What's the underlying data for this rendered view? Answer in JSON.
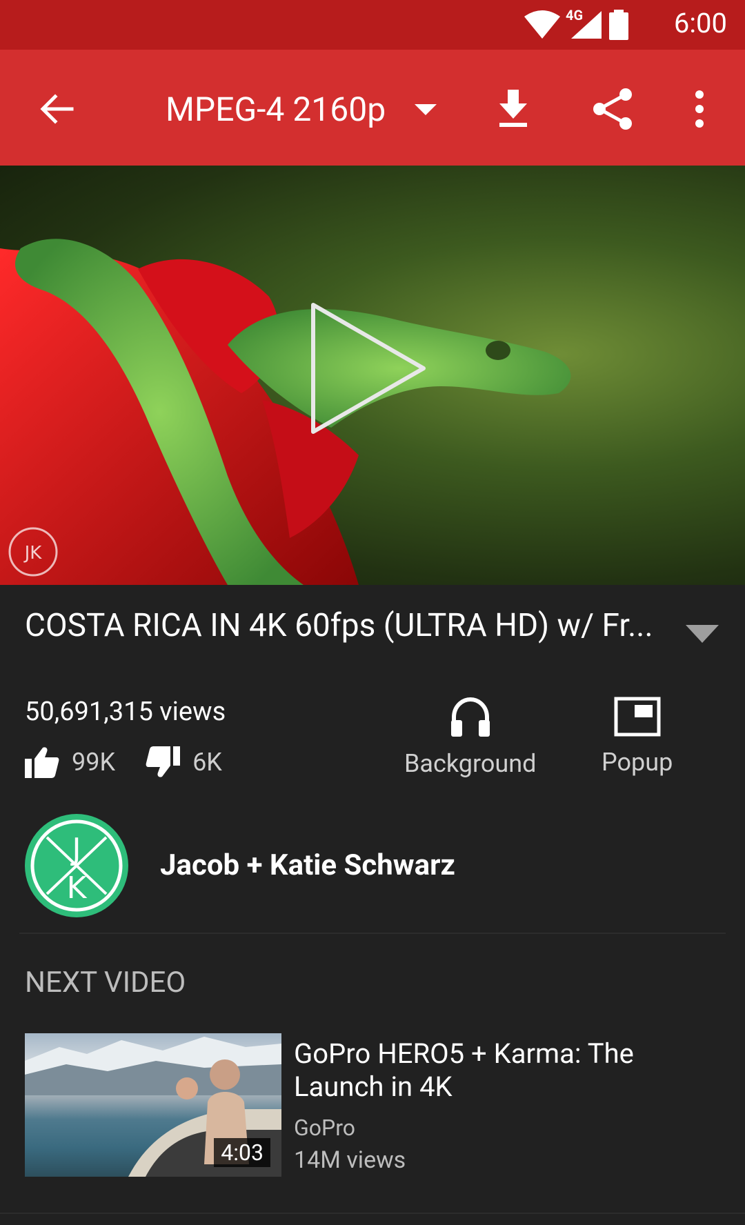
{
  "status_bar": {
    "time": "6:00",
    "network": "4G"
  },
  "app_bar": {
    "quality": "MPEG-4 2160p"
  },
  "player": {
    "watermark": "JK"
  },
  "video": {
    "title": "COSTA RICA IN 4K 60fps (ULTRA HD) w/ Fr...",
    "views": "50,691,315 views",
    "likes": "99K",
    "dislikes": "6K"
  },
  "actions": {
    "background_label": "Background",
    "popup_label": "Popup"
  },
  "uploader": {
    "name": "Jacob + Katie Schwarz",
    "avatar_text": "JK",
    "avatar_color": "#2ebd7a"
  },
  "next_video": {
    "section_label": "NEXT VIDEO",
    "title": "GoPro HERO5 + Karma: The Launch in 4K",
    "channel": "GoPro",
    "views": "14M views",
    "duration": "4:03"
  },
  "colors": {
    "status_bar": "#b71c1c",
    "app_bar": "#d32f2f",
    "background": "#212121"
  }
}
